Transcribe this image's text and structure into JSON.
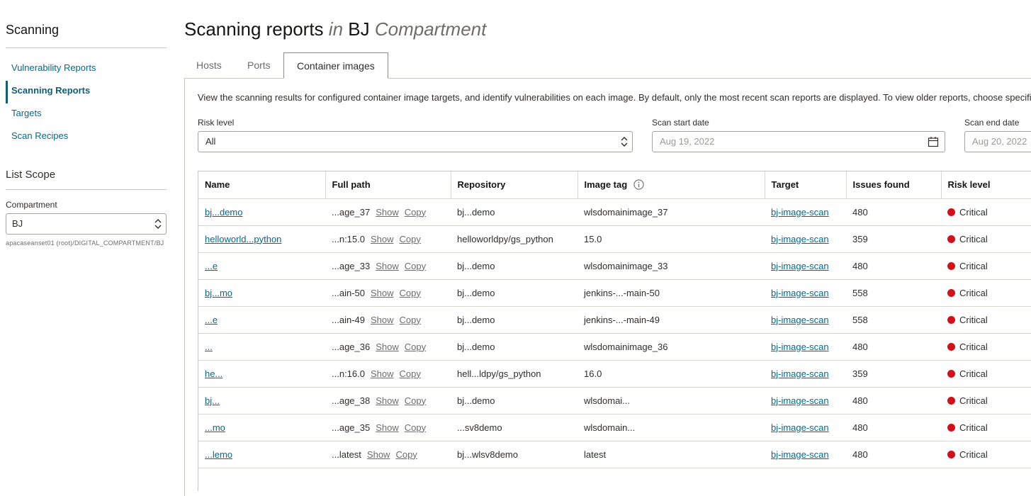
{
  "sidebar": {
    "title": "Scanning",
    "nav": [
      {
        "label": "Vulnerability Reports",
        "active": false
      },
      {
        "label": "Scanning Reports",
        "active": true
      },
      {
        "label": "Targets",
        "active": false
      },
      {
        "label": "Scan Recipes",
        "active": false
      }
    ],
    "scope_title": "List Scope",
    "compartment_label": "Compartment",
    "compartment_value": "BJ",
    "compartment_path": "apacaseanset01 (root)/DIGITAL_COMPARTMENT/BJ"
  },
  "header": {
    "title_main": "Scanning reports",
    "title_in": "in",
    "title_name": "BJ",
    "title_suffix": "Compartment"
  },
  "tabs": [
    "Hosts",
    "Ports",
    "Container images"
  ],
  "active_tab": "Container images",
  "description": "View the scanning results for configured container image targets, and identify vulnerabilities on each image. By default, only the most recent scan reports are displayed. To view older reports, choose specific dates.",
  "filters": {
    "risk_label": "Risk level",
    "risk_value": "All",
    "start_label": "Scan start date",
    "start_value": "Aug 19, 2022",
    "end_label": "Scan end date",
    "end_value": "Aug 20, 2022"
  },
  "table": {
    "headers": [
      "Name",
      "Full path",
      "Repository",
      "Image tag",
      "Target",
      "Issues found",
      "Risk level"
    ],
    "show_label": "Show",
    "copy_label": "Copy",
    "rows": [
      {
        "name": "bj...demo",
        "path": "...age_37",
        "repo": "bj...demo",
        "tag": "wlsdomainimage_37",
        "target": "bj-image-scan",
        "issues": "480",
        "risk": "Critical"
      },
      {
        "name": "helloworld...python",
        "path": "...n:15.0",
        "repo": "helloworldpy/gs_python",
        "tag": "15.0",
        "target": "bj-image-scan",
        "issues": "359",
        "risk": "Critical"
      },
      {
        "name": "...e",
        "path": "...age_33",
        "repo": "bj...demo",
        "tag": "wlsdomainimage_33",
        "target": "bj-image-scan",
        "issues": "480",
        "risk": "Critical"
      },
      {
        "name": "bj...mo",
        "path": "...ain-50",
        "repo": "bj...demo",
        "tag": "jenkins-...-main-50",
        "target": "bj-image-scan",
        "issues": "558",
        "risk": "Critical"
      },
      {
        "name": "...e",
        "path": "...ain-49",
        "repo": "bj...demo",
        "tag": "jenkins-...-main-49",
        "target": "bj-image-scan",
        "issues": "558",
        "risk": "Critical"
      },
      {
        "name": "...",
        "path": "...age_36",
        "repo": "bj...demo",
        "tag": "wlsdomainimage_36",
        "target": "bj-image-scan",
        "issues": "480",
        "risk": "Critical"
      },
      {
        "name": "he...",
        "path": "...n:16.0",
        "repo": "hell...ldpy/gs_python",
        "tag": "16.0",
        "target": "bj-image-scan",
        "issues": "359",
        "risk": "Critical"
      },
      {
        "name": "bj...",
        "path": "...age_38",
        "repo": "bj...demo",
        "tag": "wlsdomai...",
        "target": "bj-image-scan",
        "issues": "480",
        "risk": "Critical"
      },
      {
        "name": "...mo",
        "path": "...age_35",
        "repo": "...sv8demo",
        "tag": "wlsdomain...",
        "target": "bj-image-scan",
        "issues": "480",
        "risk": "Critical"
      },
      {
        "name": "...lemo",
        "path": "...latest",
        "repo": "bj...wlsv8demo",
        "tag": "latest",
        "target": "bj-image-scan",
        "issues": "480",
        "risk": "Critical"
      }
    ]
  },
  "colors": {
    "link": "#006b8f",
    "critical": "#d0101b",
    "border": "#c9c6c2"
  }
}
